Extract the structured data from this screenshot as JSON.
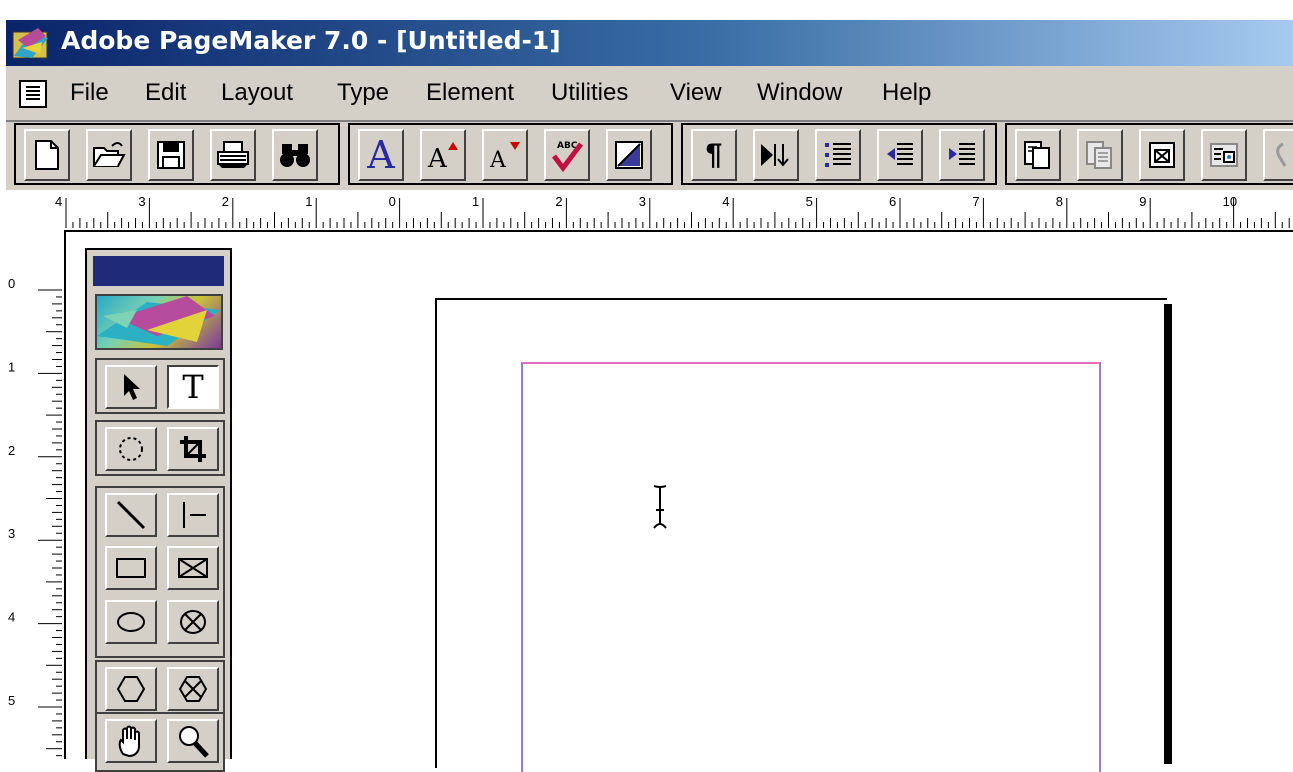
{
  "window": {
    "title": "Adobe PageMaker 7.0 - [Untitled-1]",
    "accent_colors": {
      "titlebar_start": "#0a246a",
      "titlebar_end": "#a6caf0",
      "chrome": "#d4d0c8",
      "margin_guide_top": "#e86cc0",
      "margin_guide_side": "#9a7ad8"
    }
  },
  "menubar": {
    "items": [
      "File",
      "Edit",
      "Layout",
      "Type",
      "Element",
      "Utilities",
      "View",
      "Window",
      "Help"
    ]
  },
  "toolbar": {
    "buttons": [
      {
        "name": "new-icon"
      },
      {
        "name": "open-icon"
      },
      {
        "name": "save-icon"
      },
      {
        "name": "print-icon"
      },
      {
        "name": "find-icon"
      },
      {
        "name": "character-style-icon",
        "glyph": "A"
      },
      {
        "name": "font-size-up-icon",
        "glyph": "A"
      },
      {
        "name": "font-size-down-icon",
        "glyph": "A"
      },
      {
        "name": "spell-check-icon",
        "glyph": "ABC"
      },
      {
        "name": "fill-stroke-icon"
      },
      {
        "name": "paragraph-icon",
        "glyph": "¶"
      },
      {
        "name": "indents-tabs-icon"
      },
      {
        "name": "bullets-icon"
      },
      {
        "name": "outdent-icon"
      },
      {
        "name": "indent-icon"
      },
      {
        "name": "place-icon"
      },
      {
        "name": "copy-disabled-icon"
      },
      {
        "name": "insert-object-icon"
      },
      {
        "name": "image-icon"
      },
      {
        "name": "hyperlink-icon"
      }
    ]
  },
  "rulers": {
    "horizontal_labels": [
      "4",
      "3",
      "2",
      "1",
      "0",
      "1",
      "2",
      "3",
      "4",
      "5",
      "6",
      "7",
      "8",
      "9",
      "10"
    ],
    "vertical_labels": [
      "0",
      "1",
      "2",
      "3",
      "4",
      "5"
    ]
  },
  "toolbox": {
    "tools": [
      {
        "name": "pointer-tool",
        "active": false
      },
      {
        "name": "text-tool",
        "glyph": "T",
        "active": true
      },
      {
        "name": "rotate-tool",
        "active": false
      },
      {
        "name": "crop-tool",
        "active": false
      },
      {
        "name": "line-tool",
        "active": false
      },
      {
        "name": "constrained-line-tool",
        "active": false
      },
      {
        "name": "rectangle-tool",
        "active": false
      },
      {
        "name": "rectangle-frame-tool",
        "active": false
      },
      {
        "name": "ellipse-tool",
        "active": false
      },
      {
        "name": "ellipse-frame-tool",
        "active": false
      },
      {
        "name": "polygon-tool",
        "active": false
      },
      {
        "name": "polygon-frame-tool",
        "active": false
      },
      {
        "name": "hand-tool",
        "active": false
      },
      {
        "name": "zoom-tool",
        "active": false
      }
    ]
  }
}
